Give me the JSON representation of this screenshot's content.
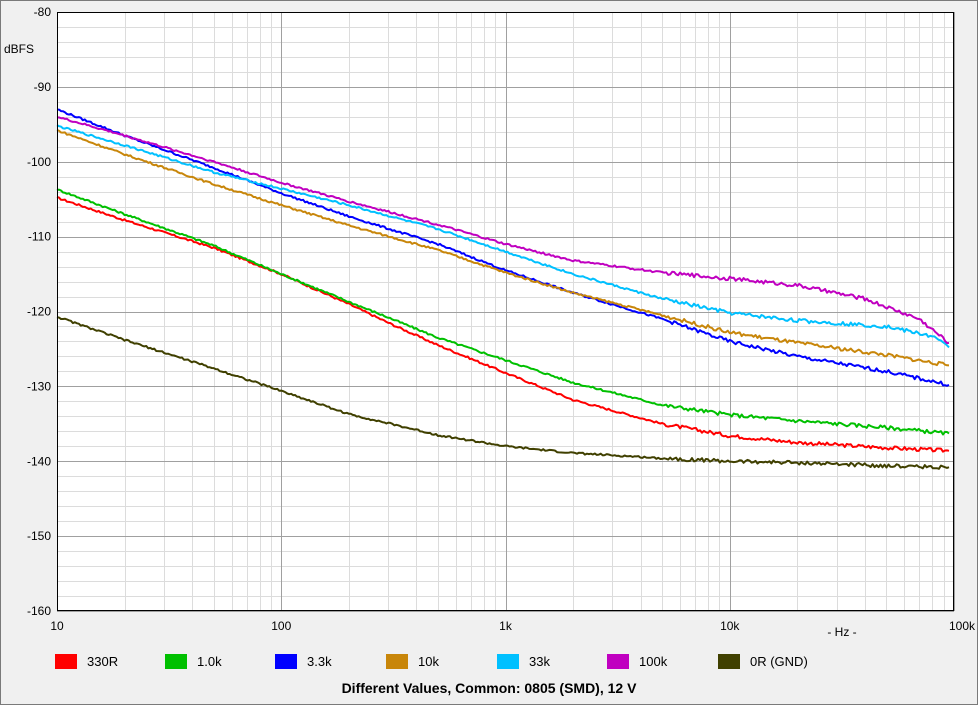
{
  "chart_data": {
    "type": "line",
    "title": "Different Values, Common: 0805 (SMD), 12 V",
    "xlabel": "- Hz -",
    "ylabel": "dBFS",
    "x_scale": "log",
    "xlim": [
      10,
      100000
    ],
    "ylim": [
      -160,
      -80
    ],
    "x_ticks": [
      {
        "value": 10,
        "label": "10"
      },
      {
        "value": 100,
        "label": "100"
      },
      {
        "value": 1000,
        "label": "1k"
      },
      {
        "value": 10000,
        "label": "10k"
      },
      {
        "value": 100000,
        "label": "100k"
      }
    ],
    "y_ticks": [
      {
        "value": -80,
        "label": "-80"
      },
      {
        "value": -90,
        "label": "-90"
      },
      {
        "value": -100,
        "label": "-100"
      },
      {
        "value": -110,
        "label": "-110"
      },
      {
        "value": -120,
        "label": "-120"
      },
      {
        "value": -130,
        "label": "-130"
      },
      {
        "value": -140,
        "label": "-140"
      },
      {
        "value": -150,
        "label": "-150"
      },
      {
        "value": -160,
        "label": "-160"
      }
    ],
    "grid": true,
    "legend_position": "bottom",
    "series": [
      {
        "name": "330R",
        "color": "#ff0000",
        "points": [
          [
            10,
            -104.8
          ],
          [
            20,
            -107.8
          ],
          [
            50,
            -111.5
          ],
          [
            100,
            -115.0
          ],
          [
            200,
            -119.0
          ],
          [
            300,
            -121.5
          ],
          [
            500,
            -124.5
          ],
          [
            1000,
            -128.2
          ],
          [
            2000,
            -131.8
          ],
          [
            5000,
            -135.0
          ],
          [
            10000,
            -136.6
          ],
          [
            20000,
            -137.5
          ],
          [
            50000,
            -138.2
          ],
          [
            95000,
            -138.6
          ]
        ]
      },
      {
        "name": "1.0k",
        "color": "#00c000",
        "points": [
          [
            10,
            -103.7
          ],
          [
            20,
            -107.0
          ],
          [
            50,
            -111.2
          ],
          [
            100,
            -115.0
          ],
          [
            200,
            -118.7
          ],
          [
            300,
            -120.8
          ],
          [
            500,
            -123.5
          ],
          [
            1000,
            -126.5
          ],
          [
            2000,
            -129.5
          ],
          [
            5000,
            -132.5
          ],
          [
            10000,
            -133.8
          ],
          [
            20000,
            -134.6
          ],
          [
            50000,
            -135.5
          ],
          [
            95000,
            -136.3
          ]
        ]
      },
      {
        "name": "3.3k",
        "color": "#0000ff",
        "points": [
          [
            10,
            -93.0
          ],
          [
            20,
            -96.5
          ],
          [
            50,
            -100.8
          ],
          [
            100,
            -104.2
          ],
          [
            200,
            -107.3
          ],
          [
            500,
            -111.0
          ],
          [
            1000,
            -114.5
          ],
          [
            2000,
            -117.5
          ],
          [
            5000,
            -121.0
          ],
          [
            10000,
            -124.0
          ],
          [
            20000,
            -126.0
          ],
          [
            50000,
            -128.0
          ],
          [
            95000,
            -129.8
          ]
        ]
      },
      {
        "name": "10k",
        "color": "#c8860a",
        "points": [
          [
            10,
            -95.8
          ],
          [
            20,
            -99.0
          ],
          [
            50,
            -103.0
          ],
          [
            100,
            -105.8
          ],
          [
            200,
            -108.5
          ],
          [
            500,
            -111.8
          ],
          [
            1000,
            -114.8
          ],
          [
            2000,
            -117.5
          ],
          [
            5000,
            -120.5
          ],
          [
            10000,
            -122.8
          ],
          [
            20000,
            -124.2
          ],
          [
            50000,
            -125.8
          ],
          [
            95000,
            -127.2
          ]
        ]
      },
      {
        "name": "33k",
        "color": "#00c0ff",
        "points": [
          [
            10,
            -95.2
          ],
          [
            20,
            -97.8
          ],
          [
            50,
            -101.4
          ],
          [
            100,
            -103.6
          ],
          [
            200,
            -105.8
          ],
          [
            500,
            -109.0
          ],
          [
            1000,
            -112.0
          ],
          [
            2000,
            -115.0
          ],
          [
            5000,
            -118.3
          ],
          [
            10000,
            -120.2
          ],
          [
            20000,
            -121.2
          ],
          [
            50000,
            -122.0
          ],
          [
            80000,
            -123.3
          ],
          [
            95000,
            -124.8
          ]
        ]
      },
      {
        "name": "100k",
        "color": "#c000c0",
        "points": [
          [
            10,
            -94.0
          ],
          [
            20,
            -96.5
          ],
          [
            50,
            -100.0
          ],
          [
            100,
            -102.8
          ],
          [
            200,
            -105.3
          ],
          [
            500,
            -108.4
          ],
          [
            1000,
            -111.0
          ],
          [
            2000,
            -113.2
          ],
          [
            5000,
            -114.8
          ],
          [
            10000,
            -115.6
          ],
          [
            20000,
            -116.5
          ],
          [
            40000,
            -118.3
          ],
          [
            70000,
            -121.0
          ],
          [
            95000,
            -124.2
          ]
        ]
      },
      {
        "name": "0R (GND)",
        "color": "#404000",
        "points": [
          [
            10,
            -120.7
          ],
          [
            20,
            -123.8
          ],
          [
            50,
            -127.6
          ],
          [
            100,
            -130.6
          ],
          [
            200,
            -133.7
          ],
          [
            500,
            -136.5
          ],
          [
            1000,
            -138.0
          ],
          [
            2000,
            -138.9
          ],
          [
            5000,
            -139.6
          ],
          [
            10000,
            -140.0
          ],
          [
            20000,
            -140.2
          ],
          [
            50000,
            -140.6
          ],
          [
            95000,
            -140.8
          ]
        ]
      }
    ]
  }
}
